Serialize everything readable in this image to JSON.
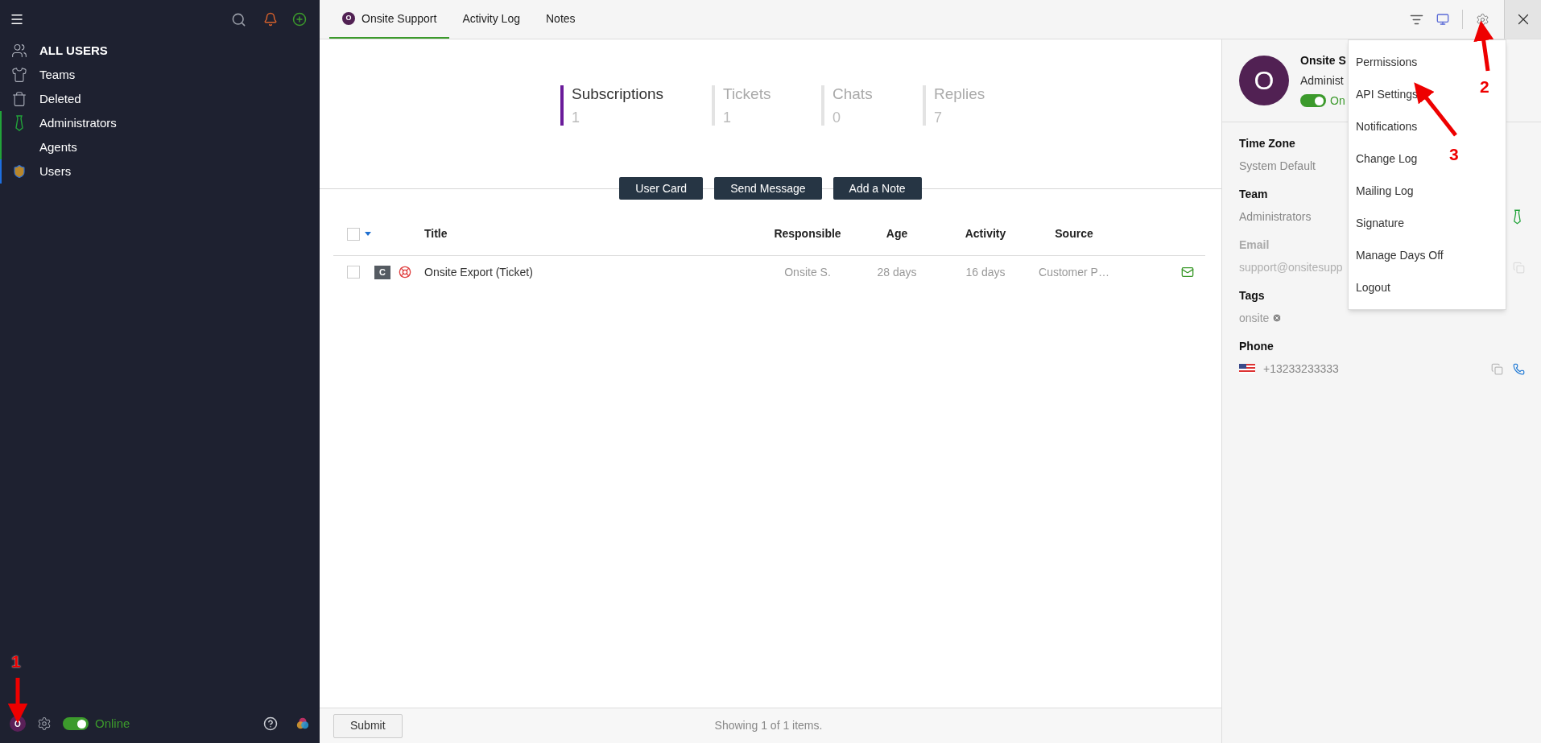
{
  "sidebar": {
    "items": [
      {
        "label": "ALL USERS",
        "kind": "header"
      },
      {
        "label": "Teams",
        "kind": "item"
      },
      {
        "label": "Deleted",
        "kind": "item"
      },
      {
        "label": "Administrators",
        "kind": "item",
        "color": "#22a33a"
      },
      {
        "label": "Agents",
        "kind": "item",
        "color": "#22a33a"
      },
      {
        "label": "Users",
        "kind": "item",
        "color": "#1e6fe0"
      }
    ],
    "footer": {
      "avatar": "O",
      "on": true,
      "status": "Online"
    }
  },
  "tabs": [
    {
      "label": "Onsite Support",
      "selected": true,
      "avatar": "O"
    },
    {
      "label": "Activity Log",
      "selected": false
    },
    {
      "label": "Notes",
      "selected": false
    }
  ],
  "stats": [
    {
      "label": "Subscriptions",
      "value": "1",
      "selected": true
    },
    {
      "label": "Tickets",
      "value": "1",
      "selected": false
    },
    {
      "label": "Chats",
      "value": "0",
      "selected": false
    },
    {
      "label": "Replies",
      "value": "7",
      "selected": false
    }
  ],
  "actions": [
    "User Card",
    "Send Message",
    "Add a Note"
  ],
  "table": {
    "columns": [
      "Title",
      "Responsible",
      "Age",
      "Activity",
      "Source"
    ],
    "select_all": {
      "checked": false
    },
    "rows": [
      {
        "checked": false,
        "badge": "C",
        "title": "Onsite Export (Ticket)",
        "responsible": "Onsite S.",
        "age": "28 days",
        "activity": "16 days",
        "source": "Customer P…"
      }
    ]
  },
  "footer": {
    "submit": "Submit",
    "summary": "Showing 1 of 1 items."
  },
  "profile": {
    "avatar": "O",
    "name": "Onsite S",
    "role": "Administ",
    "on": true,
    "status": "On",
    "fields": [
      {
        "kind": "text",
        "label": "Time Zone",
        "value": "System Default",
        "disabled": false
      },
      {
        "kind": "team",
        "label": "Team",
        "value": "Administrators",
        "disabled": false
      },
      {
        "kind": "email",
        "label": "Email",
        "value": "support@onsitesupp",
        "disabled": true
      },
      {
        "kind": "tag",
        "label": "Tags",
        "value": "onsite",
        "disabled": false
      },
      {
        "kind": "phone",
        "label": "Phone",
        "value": "+13233233333",
        "disabled": false
      }
    ]
  },
  "menu": {
    "items": [
      "Permissions",
      "API Settings",
      "Notifications",
      "Change Log",
      "Mailing Log",
      "Signature",
      "Manage Days Off",
      "Logout"
    ]
  },
  "annotations": [
    {
      "label": "1"
    },
    {
      "label": "2"
    },
    {
      "label": "3"
    }
  ]
}
